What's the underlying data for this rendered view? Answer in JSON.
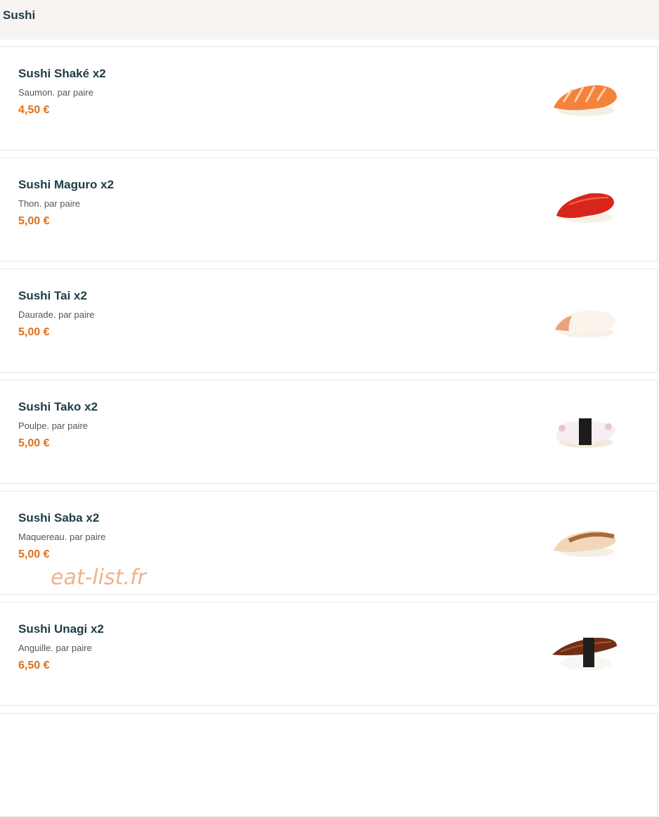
{
  "section": {
    "title": "Sushi"
  },
  "items": [
    {
      "name": "Sushi Shaké x2",
      "description": "Saumon. par paire",
      "price": "4,50 €",
      "image": "salmon-nigiri-icon"
    },
    {
      "name": "Sushi Maguro x2",
      "description": "Thon. par paire",
      "price": "5,00 €",
      "image": "tuna-nigiri-icon"
    },
    {
      "name": "Sushi Tai x2",
      "description": "Daurade. par paire",
      "price": "5,00 €",
      "image": "sea-bream-nigiri-icon"
    },
    {
      "name": "Sushi Tako x2",
      "description": "Poulpe. par paire",
      "price": "5,00 €",
      "image": "octopus-nigiri-icon"
    },
    {
      "name": "Sushi Saba x2",
      "description": "Maquereau. par paire",
      "price": "5,00 €",
      "image": "mackerel-nigiri-icon"
    },
    {
      "name": "Sushi Unagi x2",
      "description": "Anguille. par paire",
      "price": "6,50 €",
      "image": "eel-nigiri-icon"
    }
  ],
  "watermark": "eat-list.fr",
  "colors": {
    "title": "#1d3c45",
    "price": "#e0701a",
    "header_bg": "#f7f4f1"
  }
}
